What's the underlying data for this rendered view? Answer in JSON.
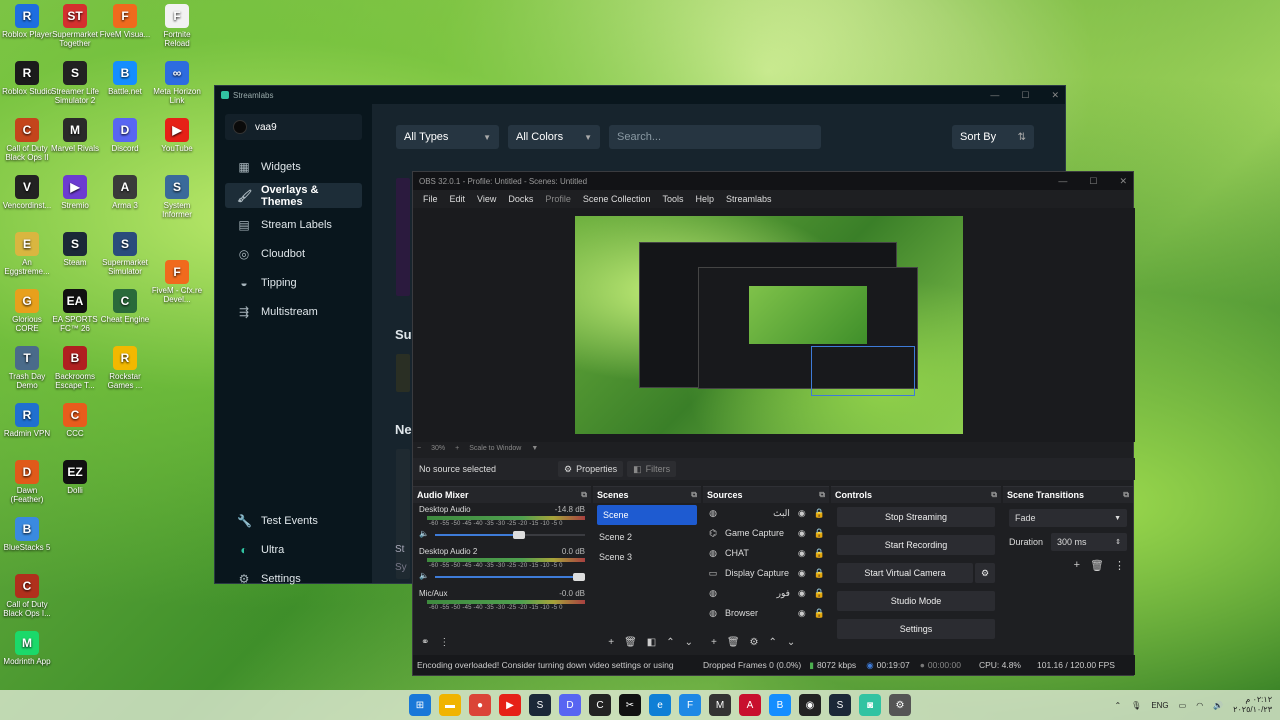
{
  "desktop": {
    "icons": [
      {
        "label": "Roblox Player",
        "color": "#1e6ee0",
        "glyph": "R"
      },
      {
        "label": "Supermarket Together",
        "color": "#d4302e",
        "glyph": "ST"
      },
      {
        "label": "Roblox Studio",
        "color": "#1b1b1b",
        "glyph": "R"
      },
      {
        "label": "Streamer Life Simulator 2",
        "color": "#222",
        "glyph": "S"
      },
      {
        "label": "FiveM Visua...",
        "color": "#f06a1d",
        "glyph": "F"
      },
      {
        "label": "Fortnite Reload",
        "color": "#f2f2f2",
        "glyph": "F"
      },
      {
        "label": "Call of Duty Black Ops II",
        "color": "#c4451c",
        "glyph": "C"
      },
      {
        "label": "Marvel Rivals",
        "color": "#2a2a2a",
        "glyph": "M"
      },
      {
        "label": "Battle.net",
        "color": "#148eff",
        "glyph": "B"
      },
      {
        "label": "Meta Horizon Link",
        "color": "#2d6cdf",
        "glyph": "∞"
      },
      {
        "label": "Vencordinst...",
        "color": "#222",
        "glyph": "V"
      },
      {
        "label": "Stremio",
        "color": "#6c3bd1",
        "glyph": "▶"
      },
      {
        "label": "Discord",
        "color": "#5865f2",
        "glyph": "D"
      },
      {
        "label": "YouTube",
        "color": "#e62117",
        "glyph": "▶"
      },
      {
        "label": "An Eggstreme...",
        "color": "#d9b640",
        "glyph": "E"
      },
      {
        "label": "Steam",
        "color": "#1b2838",
        "glyph": "S"
      },
      {
        "label": "Glorious CORE",
        "color": "#e8a01c",
        "glyph": "G"
      },
      {
        "label": "EA SPORTS FC™ 26",
        "color": "#111",
        "glyph": "EA"
      },
      {
        "label": "Trash Day Demo",
        "color": "#4a6b8a",
        "glyph": "T"
      },
      {
        "label": "Backrooms Escape T...",
        "color": "#b02020",
        "glyph": "B"
      },
      {
        "label": "Arma 3",
        "color": "#3a3a3a",
        "glyph": "A"
      },
      {
        "label": "Radmin VPN",
        "color": "#2070d0",
        "glyph": "R"
      },
      {
        "label": "CCC",
        "color": "#e85c1c",
        "glyph": "C"
      },
      {
        "label": "Supermarket Simulator",
        "color": "#2a4c7c",
        "glyph": "S"
      },
      {
        "label": "System Informer",
        "color": "#3a6a9a",
        "glyph": "S"
      },
      {
        "label": "Dawn (Feather)",
        "color": "#e05a1a",
        "glyph": "D"
      },
      {
        "label": "Dolli",
        "color": "#111",
        "glyph": "EZ"
      },
      {
        "label": "Cheat Engine",
        "color": "#2a6a3a",
        "glyph": "C"
      },
      {
        "label": "BlueStacks 5",
        "color": "#3a8ae0",
        "glyph": "B"
      },
      {
        "label": "Call of Duty Black Ops I...",
        "color": "#b0301c",
        "glyph": "C"
      },
      {
        "label": "Rockstar Games ...",
        "color": "#f2b800",
        "glyph": "R"
      },
      {
        "label": "FiveM - Cfx.re Devel...",
        "color": "#f06a1d",
        "glyph": "F"
      },
      {
        "label": "Modrinth App",
        "color": "#1bd96a",
        "glyph": "M"
      }
    ]
  },
  "streamlabs": {
    "title": "Streamlabs",
    "username": "vaa9",
    "nav": [
      {
        "label": "Widgets",
        "icon": "grid-icon"
      },
      {
        "label": "Overlays & Themes",
        "icon": "brush-icon"
      },
      {
        "label": "Stream Labels",
        "icon": "label-icon"
      },
      {
        "label": "Cloudbot",
        "icon": "bot-icon"
      },
      {
        "label": "Tipping",
        "icon": "tip-icon"
      },
      {
        "label": "Multistream",
        "icon": "multistream-icon"
      }
    ],
    "nav_bottom": [
      {
        "label": "Test Events",
        "icon": "wrench-icon"
      },
      {
        "label": "Ultra",
        "icon": "ultra-icon"
      },
      {
        "label": "Settings",
        "icon": "gear-icon"
      }
    ],
    "filters": {
      "types": "All Types",
      "colors": "All Colors",
      "search_placeholder": "Search...",
      "sort": "Sort By"
    },
    "partial_headings": [
      "Su",
      "Ne",
      "St",
      "Sy"
    ]
  },
  "obs": {
    "title": "OBS 32.0.1 - Profile: Untitled - Scenes: Untitled",
    "menu": [
      "File",
      "Edit",
      "View",
      "Docks",
      "Profile",
      "Scene Collection",
      "Tools",
      "Help",
      "Streamlabs"
    ],
    "zoom": {
      "minus": "−",
      "percent": "30%",
      "plus": "+",
      "mode": "Scale to Window"
    },
    "source_bar": {
      "no_source": "No source selected",
      "properties": "Properties",
      "filters": "Filters"
    },
    "audio_mixer": {
      "title": "Audio Mixer",
      "scale": "-60 -55 -50 -45 -40 -35 -30 -25 -20 -15 -10 -5 0",
      "channels": [
        {
          "name": "Desktop Audio",
          "db": "-14.8 dB",
          "level": 0.6
        },
        {
          "name": "Desktop Audio 2",
          "db": "0.0 dB",
          "level": 1.0
        },
        {
          "name": "Mic/Aux",
          "db": "-0.0 dB",
          "level": 1.0
        }
      ]
    },
    "scenes": {
      "title": "Scenes",
      "items": [
        "Scene",
        "Scene 2",
        "Scene 3"
      ],
      "selected": 0
    },
    "sources": {
      "title": "Sources",
      "items": [
        {
          "name": "البث",
          "icon": "browser-icon"
        },
        {
          "name": "Game Capture",
          "icon": "gamepad-icon"
        },
        {
          "name": "CHAT",
          "icon": "browser-icon"
        },
        {
          "name": "Display Capture",
          "icon": "monitor-icon"
        },
        {
          "name": "فور",
          "icon": "browser-icon"
        },
        {
          "name": "Browser",
          "icon": "browser-icon"
        }
      ]
    },
    "controls": {
      "title": "Controls",
      "buttons": [
        "Stop Streaming",
        "Start Recording",
        "Start Virtual Camera",
        "Studio Mode",
        "Settings"
      ]
    },
    "transitions": {
      "title": "Scene Transitions",
      "selected": "Fade",
      "duration_label": "Duration",
      "duration_value": "300 ms"
    },
    "status": {
      "warning": "Encoding overloaded! Consider turning down video settings or using",
      "dropped": "Dropped Frames 0 (0.0%)",
      "bitrate": "8072 kbps",
      "stream_time": "00:19:07",
      "rec_time": "00:00:00",
      "cpu": "CPU: 4.8%",
      "fps": "101.16 / 120.00 FPS"
    }
  },
  "taskbar": {
    "apps": [
      {
        "name": "windows-start-icon",
        "color": "#1a78d8",
        "glyph": "⊞"
      },
      {
        "name": "file-explorer-icon",
        "color": "#f0b400",
        "glyph": "▬"
      },
      {
        "name": "chrome-icon",
        "color": "#db4437",
        "glyph": "●"
      },
      {
        "name": "youtube-icon",
        "color": "#e62117",
        "glyph": "▶"
      },
      {
        "name": "steam-icon",
        "color": "#1b2838",
        "glyph": "S"
      },
      {
        "name": "discord-icon",
        "color": "#5865f2",
        "glyph": "D"
      },
      {
        "name": "cod-icon",
        "color": "#222",
        "glyph": "C"
      },
      {
        "name": "capcut-icon",
        "color": "#111",
        "glyph": "✂"
      },
      {
        "name": "edge-icon",
        "color": "#0f7fd6",
        "glyph": "e"
      },
      {
        "name": "fiveм-icon",
        "color": "#1e88e5",
        "glyph": "F"
      },
      {
        "name": "marvel-icon",
        "color": "#333",
        "glyph": "M"
      },
      {
        "name": "adobe-icon",
        "color": "#c8102e",
        "glyph": "A"
      },
      {
        "name": "battlenet-icon",
        "color": "#148eff",
        "glyph": "B"
      },
      {
        "name": "obs-icon",
        "color": "#222",
        "glyph": "◉"
      },
      {
        "name": "steam2-icon",
        "color": "#1b2838",
        "glyph": "S"
      },
      {
        "name": "streamlabs-icon",
        "color": "#31c3a2",
        "glyph": "◙"
      },
      {
        "name": "settings-icon",
        "color": "#555",
        "glyph": "⚙"
      }
    ],
    "tray": {
      "lang": "ENG",
      "time": "٠٢:١٢ م",
      "date": "٢٠٢٥/١٠/٢٣"
    }
  }
}
